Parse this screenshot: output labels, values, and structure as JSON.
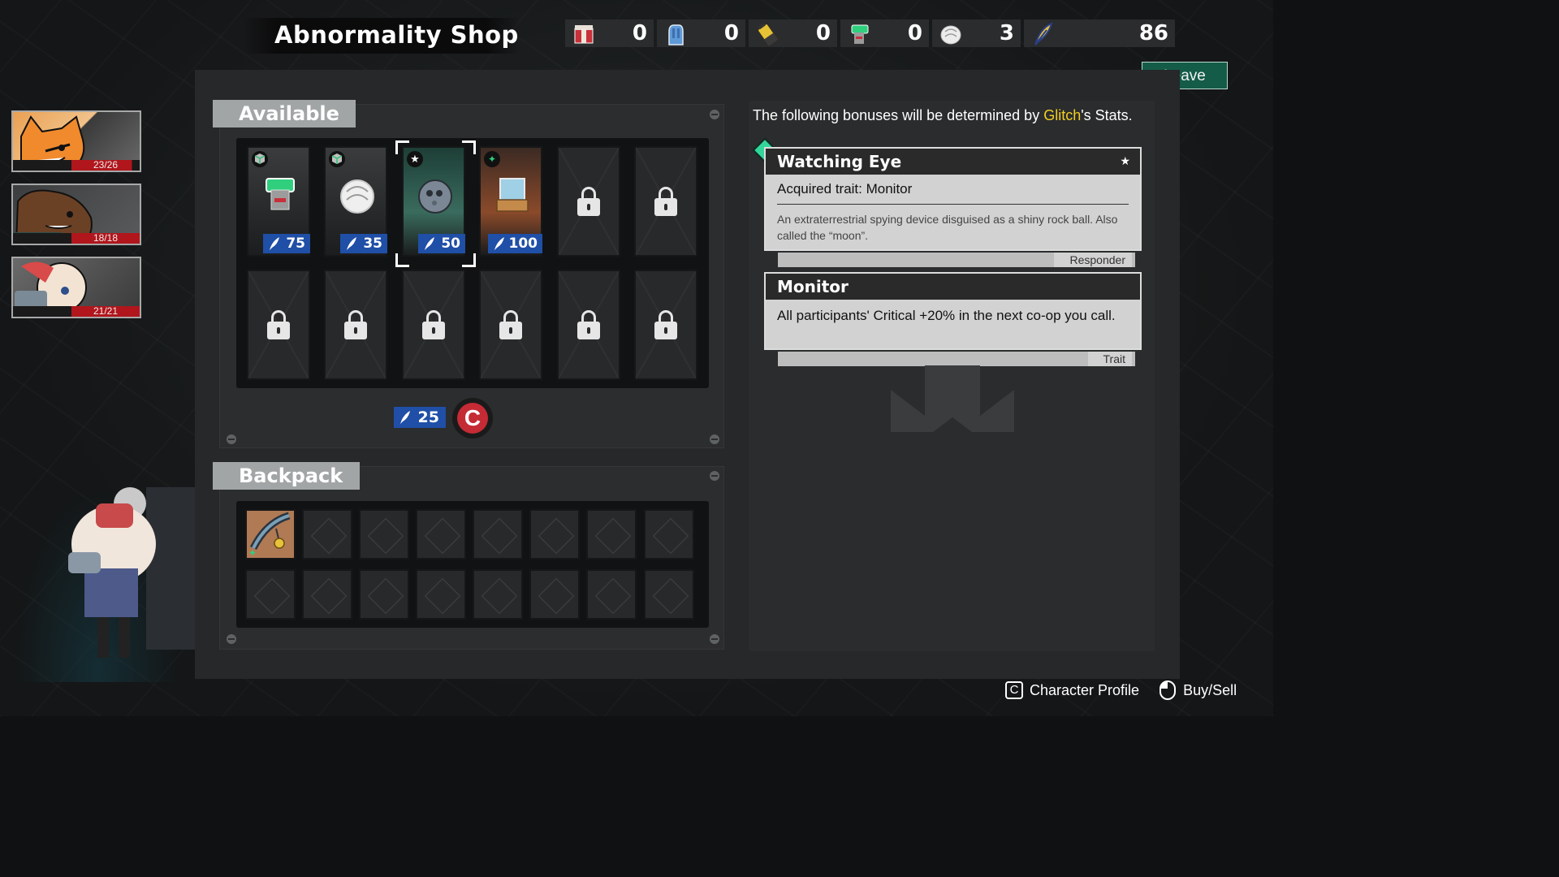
{
  "shop": {
    "title": "Abnormality Shop",
    "leave_label": "Leave"
  },
  "currencies": [
    {
      "icon": "red-box-icon",
      "value": "0"
    },
    {
      "icon": "blue-glove-icon",
      "value": "0"
    },
    {
      "icon": "yellow-battery-icon",
      "value": "0"
    },
    {
      "icon": "green-device-icon",
      "value": "0"
    },
    {
      "icon": "white-shell-icon",
      "value": "3"
    },
    {
      "icon": "feather-icon",
      "value": "86"
    }
  ],
  "party": [
    {
      "name": "fox",
      "hp": "23/26",
      "hp_fraction": 0.885
    },
    {
      "name": "bear",
      "hp": "18/18",
      "hp_fraction": 1.0
    },
    {
      "name": "sheep",
      "hp": "21/21",
      "hp_fraction": 1.0
    }
  ],
  "available": {
    "label": "Available",
    "items": [
      {
        "icon": "green-device-icon",
        "price": "75",
        "badge": "cube-icon",
        "style": "common"
      },
      {
        "icon": "white-shell-icon",
        "price": "35",
        "badge": "cube-icon",
        "style": "common"
      },
      {
        "icon": "moon-rock-icon",
        "price": "50",
        "badge": "star-icon",
        "style": "rare",
        "selected": true
      },
      {
        "icon": "hourglass-crate-icon",
        "price": "100",
        "badge": "sparkle-star-icon",
        "style": "epic"
      }
    ],
    "reroll_price": "25",
    "reroll_symbol": "C"
  },
  "backpack": {
    "label": "Backpack"
  },
  "details": {
    "intro_before": "The following bonuses will be determined by ",
    "intro_name": "Glitch",
    "intro_after": "'s Stats.",
    "item_card": {
      "title": "Watching Eye",
      "star": "★",
      "trait_line": "Acquired trait: Monitor",
      "description": "An extraterrestrial spying device disguised as a shiny rock ball. Also called the “moon”.",
      "tag": "Responder"
    },
    "trait_card": {
      "title": "Monitor",
      "description": "All participants' Critical +20% in the next co-op you call.",
      "tag": "Trait"
    }
  },
  "footer": {
    "profile_key": "C",
    "profile_label": "Character Profile",
    "buysell_label": "Buy/Sell"
  },
  "colors": {
    "accent_green": "#145c48",
    "price_blue": "#1f4fa7",
    "reroll_red": "#c52b35",
    "highlight_yellow": "#f3cf24",
    "hp_red": "#b0161c"
  }
}
